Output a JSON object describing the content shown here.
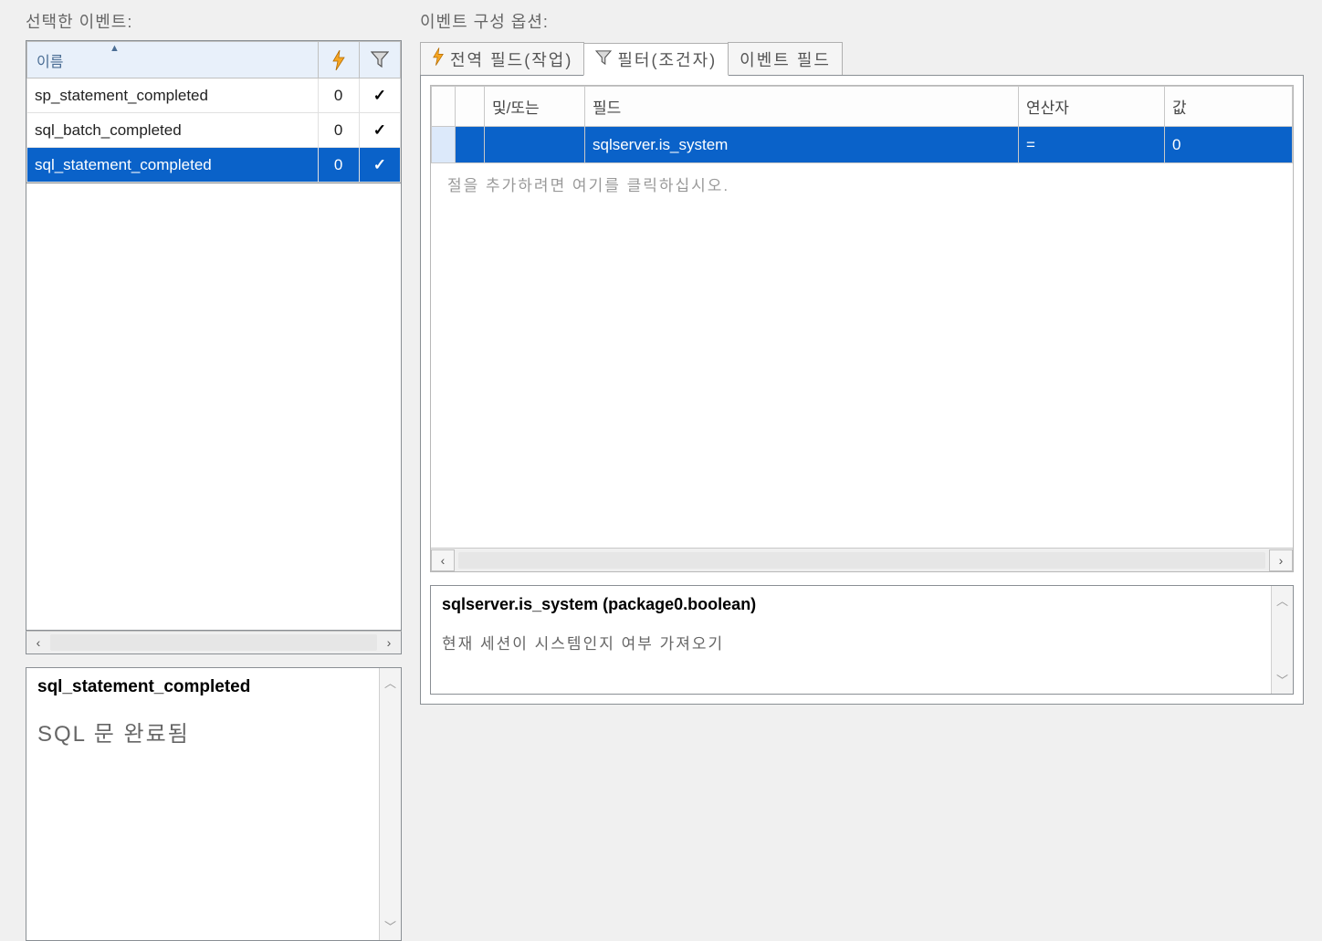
{
  "leftLabel": "선택한 이벤트:",
  "rightLabel": "이벤트 구성 옵션:",
  "eventTable": {
    "nameHeader": "이름",
    "lightningIcon": "lightning-icon",
    "filterIcon": "filter-icon",
    "rows": [
      {
        "name": "sp_statement_completed",
        "count": "0",
        "filtered": "✓"
      },
      {
        "name": "sql_batch_completed",
        "count": "0",
        "filtered": "✓"
      },
      {
        "name": "sql_statement_completed",
        "count": "0",
        "filtered": "✓"
      }
    ]
  },
  "description": {
    "title": "sql_statement_completed",
    "text": "SQL 문 완료됨"
  },
  "tabs": {
    "tab0": "전역 필드(작업)",
    "tab1": "필터(조건자)",
    "tab2": "이벤트 필드"
  },
  "filterGrid": {
    "hAndOr": "및/또는",
    "hField": "필드",
    "hOperator": "연산자",
    "hValue": "값",
    "row": {
      "field": "sqlserver.is_system",
      "operator": "=",
      "value": "0"
    },
    "addClause": "절을 추가하려면 여기를 클릭하십시오."
  },
  "info": {
    "title": "sqlserver.is_system (package0.boolean)",
    "text": "현재 세션이 시스템인지 여부 가져오기"
  }
}
